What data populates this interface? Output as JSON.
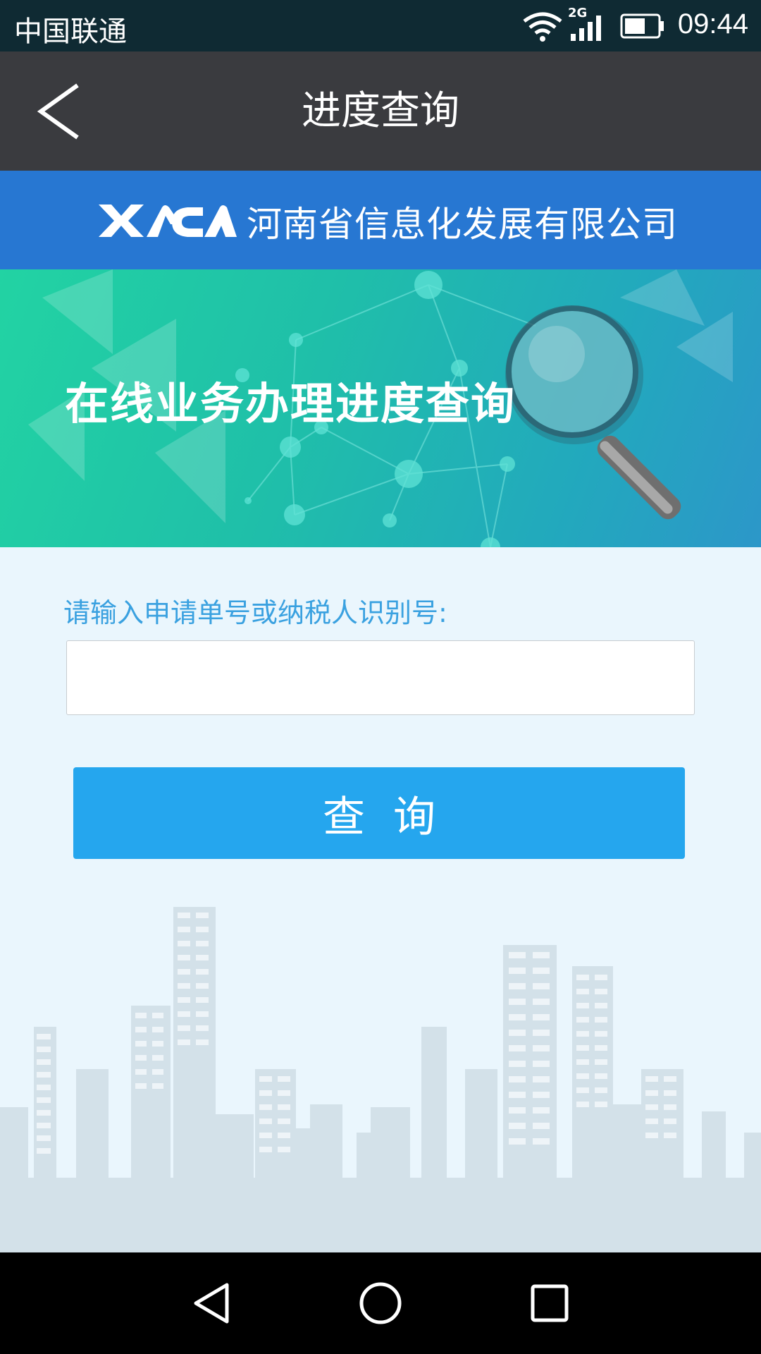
{
  "status_bar": {
    "carrier": "中国联通",
    "network_type": "2G",
    "time": "09:44",
    "icons": [
      "wifi-icon",
      "signal-icon",
      "battery-icon"
    ]
  },
  "title_bar": {
    "title": "进度查询",
    "back_icon": "chevron-left-icon"
  },
  "brand_bar": {
    "logo_text": "XACA",
    "company_name": "河南省信息化发展有限公司"
  },
  "banner": {
    "text": "在线业务办理进度查询",
    "illustration": "magnifier-icon"
  },
  "form": {
    "label": "请输入申请单号或纳税人识别号:",
    "input_value": "",
    "input_placeholder": "",
    "button_label": "查询"
  },
  "nav_bar": {
    "items": [
      "back-triangle-icon",
      "home-circle-icon",
      "recents-square-icon"
    ]
  },
  "colors": {
    "status_bar": "#0f2a33",
    "title_bar": "#3a3b3f",
    "brand_bar": "#2777d2",
    "button": "#25a6ee",
    "label": "#3aa1e0",
    "background": "#eaf6fd"
  }
}
